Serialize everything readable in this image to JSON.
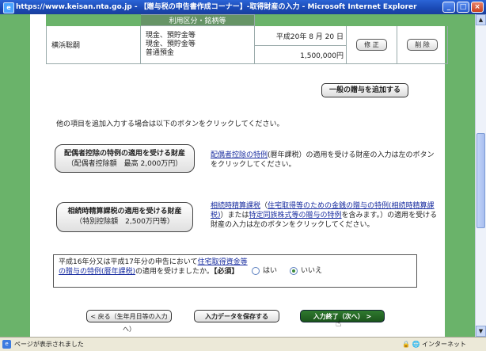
{
  "window": {
    "title": "https://www.keisan.nta.go.jp - 【贈与税の申告書作成コーナー】-取得財産の入力 - Microsoft Internet Explorer",
    "controls": [
      "_",
      "□",
      "×"
    ]
  },
  "table": {
    "header": "利用区分・銘柄等",
    "row": {
      "donor": "横浜聡嗣",
      "types": [
        "現金、預貯金等",
        "現金、預貯金等",
        "普通預金"
      ],
      "date": "平成20年 8 月 20 日",
      "amount": "1,500,000円",
      "edit_label": "修 正",
      "delete_label": "削 除"
    }
  },
  "add_general_button": "一般の贈与を追加する",
  "info_text": "他の項目を追加入力する場合は以下のボタンをクリックしてください。",
  "spouse": {
    "button_main": "配偶者控除の特例の適用を受ける財産",
    "button_sub": "（配偶者控除額　最高 2,000万円）",
    "link": "配偶者控除の特例",
    "desc": "(暦年課税）の適用を受ける財産の入力は左のボタンをクリックしてください。"
  },
  "settlement": {
    "button_main": "相続時精算課税の適用を受ける財産",
    "button_sub": "（特別控除額　2,500万円等）",
    "link1": "相続時精算課税",
    "text1": "（",
    "link2": "住宅取得等のための金銭の贈与の特例(相続時精算課税)",
    "text2": "）または",
    "link3": "特定同族株式等の贈与の特例",
    "text3": "を含みます。）の適用を受ける財産の入力は左のボタンをクリックしてください。"
  },
  "marriage": {
    "prefix": "平成16年分又は平成17年分の申告において",
    "link": "住宅取得資金等の贈与の特例(暦年課税)",
    "suffix": "の適用を受けましたか。",
    "required": "【必須】",
    "options": [
      {
        "label": "はい",
        "selected": false
      },
      {
        "label": "いいえ",
        "selected": true
      }
    ]
  },
  "nav": {
    "back": "< 戻る（生年月日等の入力へ）",
    "save": "入力データを保存する",
    "next": "入力終了（次へ） >"
  },
  "statusbar": {
    "left": "ページが表示されました",
    "right": "インターネット"
  }
}
